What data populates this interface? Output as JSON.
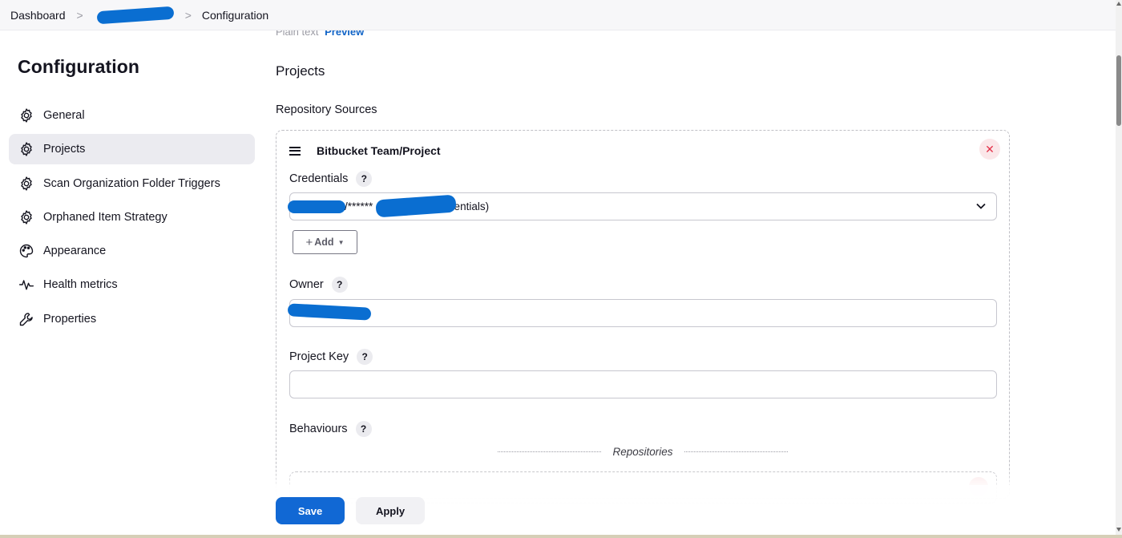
{
  "breadcrumb": {
    "items": [
      "Dashboard",
      "Configuration"
    ],
    "separator": ">"
  },
  "sidebar": {
    "title": "Configuration",
    "items": [
      {
        "label": "General",
        "icon": "gear-icon"
      },
      {
        "label": "Projects",
        "icon": "gear-icon",
        "active": true
      },
      {
        "label": "Scan Organization Folder Triggers",
        "icon": "gear-icon"
      },
      {
        "label": "Orphaned Item Strategy",
        "icon": "gear-icon"
      },
      {
        "label": "Appearance",
        "icon": "palette-icon"
      },
      {
        "label": "Health metrics",
        "icon": "pulse-icon"
      },
      {
        "label": "Properties",
        "icon": "wrench-icon"
      }
    ]
  },
  "main": {
    "plain_text": "Plain text",
    "preview": "Preview",
    "section_title": "Projects",
    "sub_title": "Repository Sources",
    "source": {
      "title": "Bitbucket Team/Project",
      "credentials": {
        "label": "Credentials",
        "help": "?",
        "value": "/****** (        -bitbucket-credentials)",
        "add_label": "Add"
      },
      "owner": {
        "label": "Owner",
        "help": "?",
        "value": ""
      },
      "project_key": {
        "label": "Project Key",
        "help": "?",
        "value": ""
      },
      "behaviours": {
        "label": "Behaviours",
        "help": "?"
      },
      "repositories_divider": "Repositories"
    }
  },
  "actions": {
    "save": "Save",
    "apply": "Apply"
  },
  "colors": {
    "primary": "#1168d4",
    "danger": "#e4324a",
    "redaction": "#0a6ed1"
  }
}
